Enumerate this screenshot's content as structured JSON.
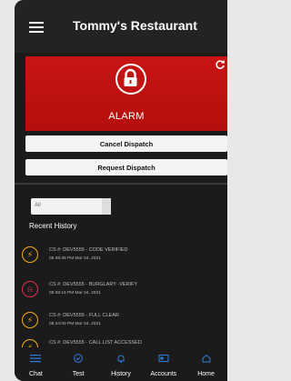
{
  "header": {
    "title": "Tommy's Restaurant"
  },
  "alarm": {
    "label": "ALARM",
    "color": "#c81414"
  },
  "buttons": {
    "cancel": "Cancel Dispatch",
    "request": "Request Dispatch"
  },
  "filter": {
    "selected": "All"
  },
  "history": {
    "title": "Recent History",
    "items": [
      {
        "title": "CS #: DEV5555 - CODE VERIFIED",
        "time": "05:38:36 PM Mar 04, 2021",
        "icon": "bolt-icon",
        "color": "#f0b020"
      },
      {
        "title": "CS #: DEV5555 - BURGLARY -VERIFY",
        "time": "05:38:16 PM Mar 04, 2021",
        "icon": "bell-icon",
        "color": "#e0304a"
      },
      {
        "title": "CS #: DEV5555 - FULL CLEAR",
        "time": "05:34:00 PM Mar 04, 2021",
        "icon": "bolt-icon",
        "color": "#f0b020"
      },
      {
        "title": "CS #: DEV5555 - CALL LIST ACCESSED",
        "time": "",
        "icon": "bolt-icon",
        "color": "#f0b020"
      }
    ]
  },
  "tabs": [
    "Chat",
    "Test",
    "History",
    "Accounts",
    "Home"
  ]
}
